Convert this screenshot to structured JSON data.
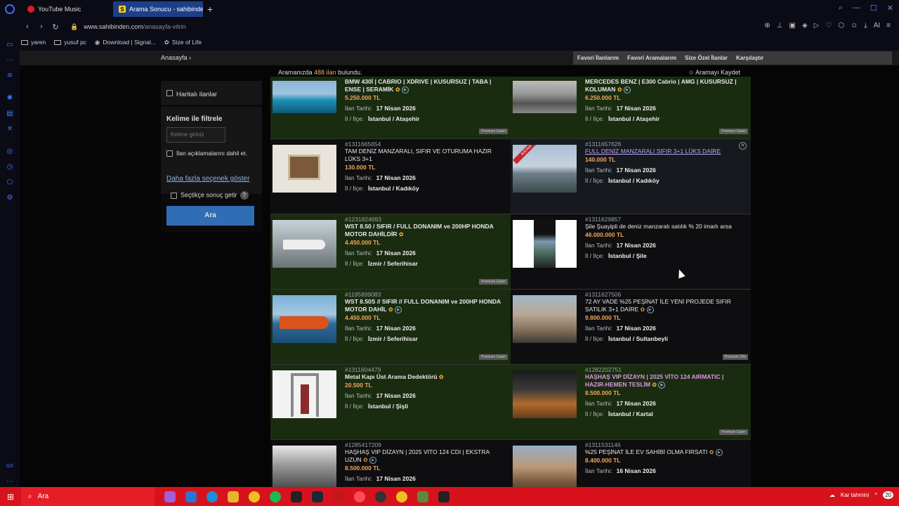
{
  "browser": {
    "tabs": [
      {
        "label": "YouTube Music",
        "active": false
      },
      {
        "label": "Arama Sonucu - sahibinden",
        "active": true
      }
    ],
    "new_tab": "+",
    "url_host": "www.sahibinden.com",
    "url_path": "/anasayfa-vitrin",
    "bookmarks": [
      "yaren",
      "yusuf pc",
      "Download | Signal...",
      "Size of Life"
    ]
  },
  "subnav": {
    "breadcrumb": "Anasayfa",
    "links": [
      "Favori İlanlarım",
      "Favori Aramalarım",
      "Size Özel İlanlar",
      "Karşılaştır"
    ]
  },
  "results": {
    "prefix": "Aramanızda",
    "count": "488 ilan",
    "suffix": "bulundu.",
    "save_search": "Aramayı Kaydet"
  },
  "filter": {
    "map_label": "Haritalı ilanlar",
    "keyword_title": "Kelime ile filtrele",
    "keyword_placeholder": "Kelime giriniz",
    "include_desc": "İlan açıklamalarını dahil et.",
    "more_options": "Daha fazla seçenek göster",
    "select_label": "Seçtikçe sonuç getir",
    "help": "?",
    "search_button": "Ara"
  },
  "labels": {
    "date": "İlan Tarihi:",
    "location": "İl / İlçe:",
    "premium": "Premium Galeri",
    "premium_ofis": "Premium Ofis",
    "acil": "Acil Acil"
  },
  "listings": [
    {
      "id": "",
      "title": "BMW 430İ | CABRIO | XDRIVE | KUSURSUZ | TABA | ENSE | SERAMİK",
      "price": "5.250.000 TL",
      "date": "17 Nisan 2026",
      "location": "İstanbul / Ataşehir"
    },
    {
      "id": "",
      "title": "MERCEDES BENZ | E300 Cabrio | AMG | KUSURSUZ | KOLUMAN",
      "price": "6.250.000 TL",
      "date": "17 Nisan 2026",
      "location": "İstanbul / Ataşehir"
    },
    {
      "id": "#1311665654",
      "title": "TAM DENİZ MANZARALI, SIFIR VE OTURUMA HAZIR LÜKS 3+1",
      "price": "130.000 TL",
      "date": "17 Nisan 2026",
      "location": "İstanbul / Kadıköy"
    },
    {
      "id": "#1311657626",
      "title": "FULL DENİZ MANZARALI SIFIR 3+1 LÜKS DAİRE",
      "price": "140.000 TL",
      "date": "17 Nisan 2026",
      "location": "İstanbul / Kadıköy"
    },
    {
      "id": "#1231824693",
      "title": "WST 8.50 / SIFIR / FULL DONANIM ve 200HP HONDA MOTOR DAHİLDİR",
      "price": "4.450.000 TL",
      "date": "17 Nisan 2026",
      "location": "İzmir / Seferihisar"
    },
    {
      "id": "#1311629857",
      "title": "Şile Şuayipli de deniz manzaralı satılık % 20 imarlı arsa",
      "price": "46.000.000 TL",
      "date": "17 Nisan 2026",
      "location": "İstanbul / Şile"
    },
    {
      "id": "#1195899083",
      "title": "WST 8.50S // SIFIR // FULL DONANIM ve 200HP HONDA MOTOR DAHİL",
      "price": "4.450.000 TL",
      "date": "17 Nisan 2026",
      "location": "İzmir / Seferihisar"
    },
    {
      "id": "#1311627506",
      "title": "72 AY VADE %25 PEŞİNAT İLE YENİ PROJEDE SIFIR SATILIK 3+1 DAİRE",
      "price": "9.800.000 TL",
      "date": "17 Nisan 2026",
      "location": "İstanbul / Sultanbeyli"
    },
    {
      "id": "#1311604479",
      "title": "Metal Kapı Üst Arama Dedektörü",
      "price": "20.500 TL",
      "date": "17 Nisan 2026",
      "location": "İstanbul / Şişli"
    },
    {
      "id": "#1282202751",
      "title": "HAŞHAŞ VIP DİZAYN | 2025 VİTO 124 AIRMATIC | HAZIR-HEMEN TESLİM",
      "price": "8.500.000 TL",
      "date": "17 Nisan 2026",
      "location": "İstanbul / Kartal"
    },
    {
      "id": "#1285417209",
      "title": "HAŞHAŞ VIP DİZAYN | 2025 VİTO 124 CDI | EKSTRA UZUN",
      "price": "8.500.000 TL",
      "date": "17 Nisan 2026",
      "location": ""
    },
    {
      "id": "#1311531146",
      "title": "%25 PEŞİNAT İLE EV SAHİBİ OLMA FIRSATI",
      "price": "8.400.000 TL",
      "date": "16 Nisan 2026",
      "location": ""
    }
  ],
  "taskbar": {
    "search": "Ara",
    "weather": "Kar tahmini",
    "notif": "20"
  },
  "colors": {
    "price": "#f2a75a",
    "accent": "#2f6db5",
    "taskbar": "#d7121d"
  }
}
